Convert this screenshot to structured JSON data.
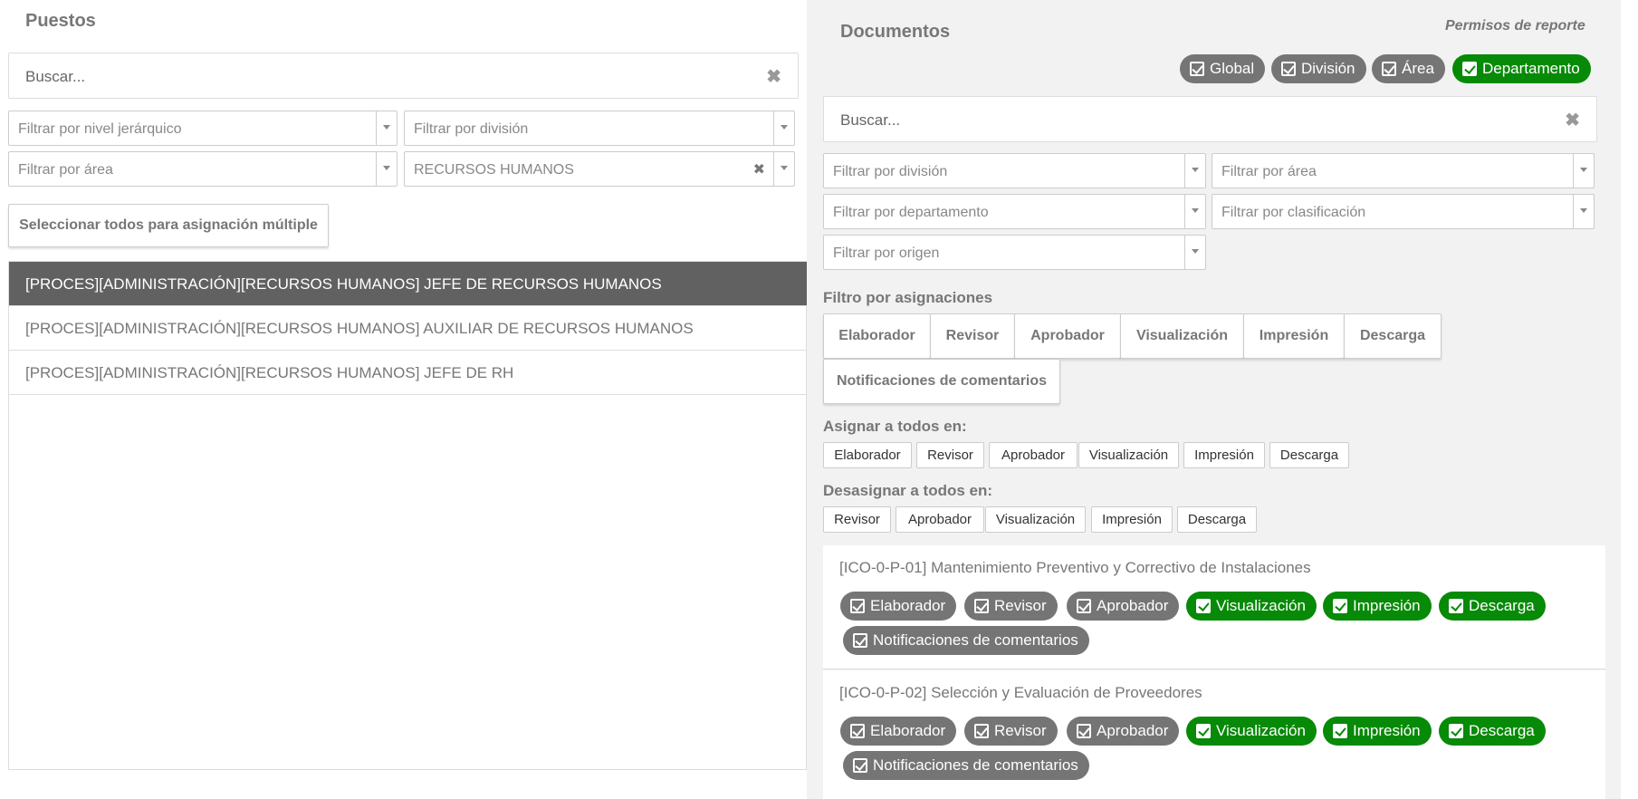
{
  "left": {
    "title": "Puestos",
    "search_placeholder": "Buscar...",
    "filters": {
      "nivel": "Filtrar por nivel jerárquico",
      "division": "Filtrar por división",
      "area": "Filtrar por área",
      "departamento_value": "RECURSOS HUMANOS"
    },
    "select_all_label": "Seleccionar todos para asignación múltiple",
    "items": [
      "[PROCES][ADMINISTRACIÓN][RECURSOS HUMANOS] JEFE DE RECURSOS HUMANOS",
      "[PROCES][ADMINISTRACIÓN][RECURSOS HUMANOS] AUXILIAR DE RECURSOS HUMANOS",
      "[PROCES][ADMINISTRACIÓN][RECURSOS HUMANOS] JEFE DE RH"
    ]
  },
  "right": {
    "title": "Documentos",
    "report_perms_label": "Permisos de reporte",
    "scope_pills": [
      {
        "label": "Global",
        "checked": true,
        "color": "gray"
      },
      {
        "label": "División",
        "checked": true,
        "color": "gray"
      },
      {
        "label": "Área",
        "checked": true,
        "color": "gray"
      },
      {
        "label": "Departamento",
        "checked": true,
        "color": "green"
      }
    ],
    "search_placeholder": "Buscar...",
    "filters": {
      "division": "Filtrar por división",
      "area": "Filtrar por área",
      "departamento": "Filtrar por departamento",
      "clasificacion": "Filtrar por clasificación",
      "origen": "Filtrar por origen"
    },
    "assign_filter_label": "Filtro por asignaciones",
    "assign_filter_buttons": [
      "Elaborador",
      "Revisor",
      "Aprobador",
      "Visualización",
      "Impresión",
      "Descarga",
      "Notificaciones de comentarios"
    ],
    "assign_all_label": "Asignar a todos en:",
    "assign_all_buttons": [
      "Elaborador",
      "Revisor",
      "Aprobador",
      "Visualización",
      "Impresión",
      "Descarga"
    ],
    "unassign_all_label": "Desasignar a todos en:",
    "unassign_all_buttons": [
      "Revisor",
      "Aprobador",
      "Visualización",
      "Impresión",
      "Descarga"
    ],
    "documents": [
      {
        "title": "[ICO-0-P-01] Mantenimiento Preventivo y Correctivo de Instalaciones",
        "perms": [
          "Elaborador",
          "Revisor",
          "Aprobador",
          "Visualización",
          "Impresión",
          "Descarga",
          "Notificaciones de comentarios"
        ]
      },
      {
        "title": "[ICO-0-P-02] Selección y Evaluación de Proveedores",
        "perms": [
          "Elaborador",
          "Revisor",
          "Aprobador",
          "Visualización",
          "Impresión",
          "Descarga",
          "Notificaciones de comentarios"
        ]
      }
    ]
  },
  "colors": {
    "active_row": "#616161",
    "green": "#078a07",
    "gray_pill": "#757575",
    "right_bg": "#f2f2f2"
  }
}
